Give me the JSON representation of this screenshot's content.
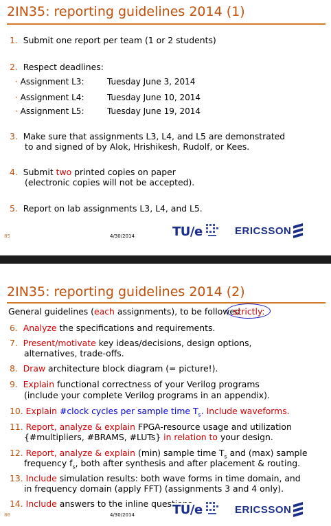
{
  "slide1": {
    "title": "2IN35: reporting guidelines 2014 (1)",
    "items": [
      {
        "num": "1.",
        "text": "Submit one report per team (1 or 2 students)"
      },
      {
        "num": "2.",
        "text": "Respect deadlines:"
      },
      {
        "num": "3.",
        "line1": "Make sure that assignments L3, L4, and L5 are demonstrated",
        "line2": "to and signed of by Alok, Hrishikesh, Rudolf, or Kees."
      },
      {
        "num": "4.",
        "pre": "Submit ",
        "red": "two",
        "post": " printed copies on paper",
        "line2": "(electronic copies will not be accepted)."
      },
      {
        "num": "5.",
        "text": "Report  on lab assignments L3, L4, and L5."
      }
    ],
    "deadlines": [
      {
        "label": "Assignment L3:",
        "date": "Tuesday June   3, 2014"
      },
      {
        "label": "Assignment L4:",
        "date": "Tuesday June 10, 2014"
      },
      {
        "label": "Assignment L5:",
        "date": "Tuesday June 19, 2014"
      }
    ],
    "page": "85",
    "date": "4/30/2014"
  },
  "slide2": {
    "title": "2IN35: reporting guidelines 2014 (2)",
    "intro": {
      "pre": "General guidelines (",
      "red": "each",
      "post": " assignments), to be followed",
      "circled": "strictly:"
    },
    "items": [
      {
        "num": "6.",
        "red": "Analyze",
        "text": " the specifications and requirements."
      },
      {
        "num": "7.",
        "red": "Present/motivate",
        "text": " key ideas/decisions, design options,",
        "line2": "alternatives, trade-offs."
      },
      {
        "num": "8.",
        "red": "Draw",
        "text": " architecture block diagram (= picture!)."
      },
      {
        "num": "9.",
        "red": "Explain",
        "text": " functional correctness of your Verilog programs",
        "line2": "(include your complete Verilog programs in an appendix)."
      },
      {
        "num": "10.",
        "red": "Explain",
        "blue1": " #clock cycles per sample time T",
        "blue_sub": "s",
        "blue2": ".",
        "red2": " Include waveforms."
      },
      {
        "num": "11.",
        "red": "Report, analyze & explain",
        "text": " FPGA-resource usage and utilization",
        "line2a": "{#multipliers, #BRAMS, #LUTs}",
        "line2_red": " in relation to",
        "line2b": " your design."
      },
      {
        "num": "12.",
        "red": "Report, analyze & explain",
        "text": " (min) sample time T",
        "sub": "s",
        "text2": " and (max) sample",
        "line2a": "frequency f",
        "line2_sub": "s",
        "line2b": ", both after synthesis and after placement & routing."
      },
      {
        "num": "13.",
        "red": "Include",
        "text": " simulation results: both wave forms in time domain, and",
        "line2": "in frequency domain (apply FFT) (assignments 3 and 4 only)."
      },
      {
        "num": "14.",
        "red": "Include",
        "text": " answers to the inline questions."
      }
    ],
    "page": "86",
    "date": "4/30/2014"
  },
  "logos": {
    "tue": "TU/e",
    "ericsson": "ERICSSON"
  }
}
